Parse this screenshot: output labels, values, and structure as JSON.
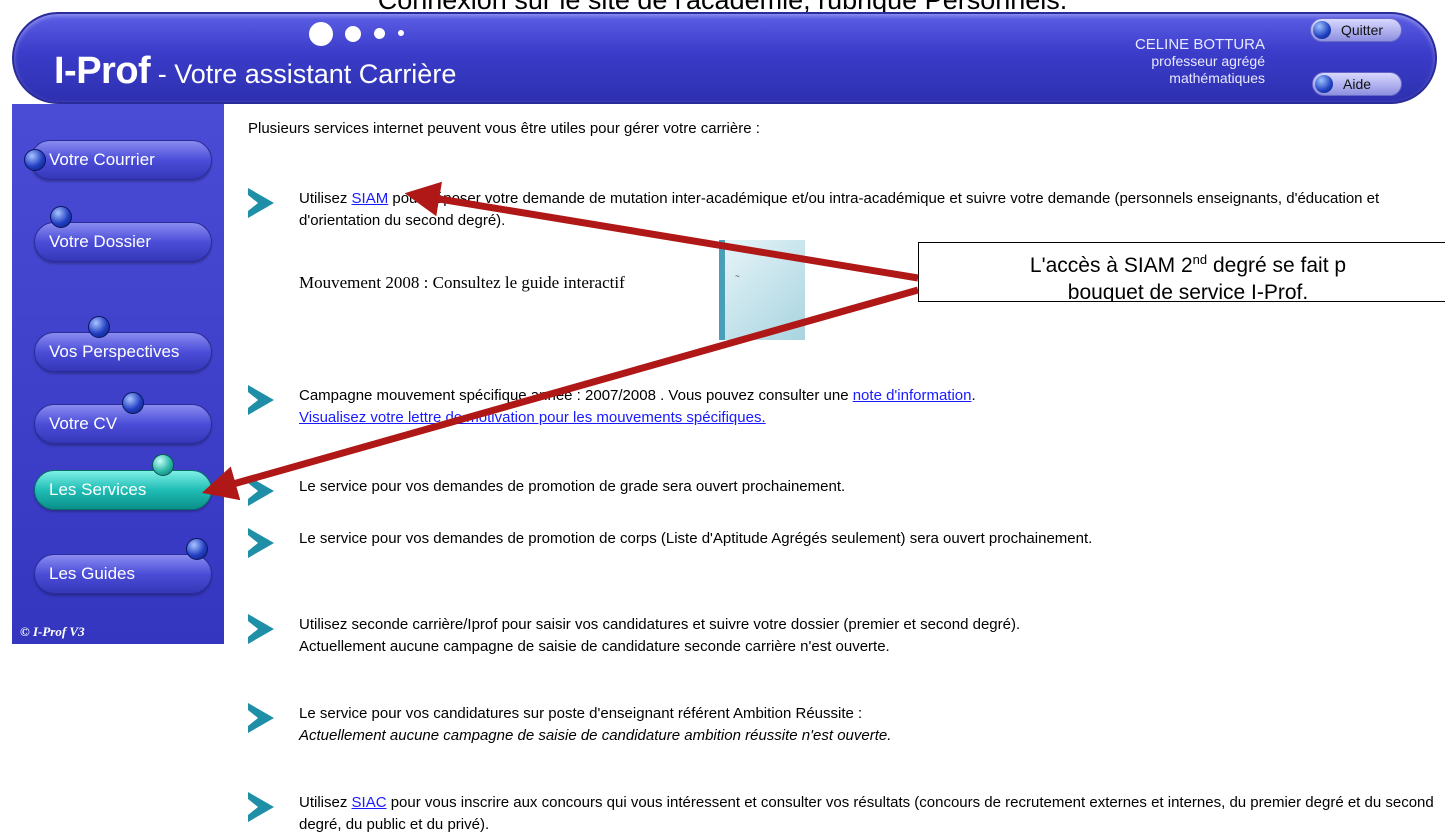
{
  "slide_caption": "Connexion sur le site de l'académie, rubrique Personnels.",
  "header": {
    "brand": "I-Prof",
    "subtitle": " - Votre assistant Carrière",
    "user_name": "CELINE BOTTURA",
    "user_role": "professeur agrégé",
    "user_subject": "mathématiques",
    "quit_label": "Quitter",
    "help_label": "Aide"
  },
  "sidebar": {
    "items": [
      {
        "label": "Votre Courrier"
      },
      {
        "label": "Votre Dossier"
      },
      {
        "label": "Vos Perspectives"
      },
      {
        "label": "Votre CV"
      },
      {
        "label": "Les Services",
        "active": true
      },
      {
        "label": "Les Guides"
      }
    ],
    "copyright": "© I-Prof  V3"
  },
  "main": {
    "intro": "Plusieurs services internet peuvent vous être utiles pour gérer votre carrière :",
    "items": [
      {
        "before": "Utilisez ",
        "link": "SIAM",
        "after": " pour déposer votre demande de mutation inter-académique et/ou intra-académique et suivre votre demande (personnels enseignants, d'éducation et d'orientation du second degré)."
      },
      {
        "line1": "Campagne mouvement spécifique année : 2007/2008 .    Vous pouvez consulter une ",
        "link1": "note d'information",
        "line1_end": ".",
        "link2": "Visualisez votre lettre de motivation pour les mouvements spécifiques."
      },
      {
        "text": "Le service pour vos demandes de promotion de grade sera ouvert prochainement."
      },
      {
        "text": "Le service pour vos demandes de promotion de corps (Liste d'Aptitude Agrégés seulement) sera ouvert prochainement."
      },
      {
        "line1": "Utilisez seconde carrière/Iprof pour saisir vos candidatures et suivre votre dossier (premier et second degré).",
        "line2": "Actuellement aucune campagne de saisie de candidature seconde carrière n'est ouverte."
      },
      {
        "line1": "Le service pour vos candidatures sur poste d'enseignant référent Ambition Réussite :",
        "line2": "Actuellement aucune campagne de saisie de candidature ambition réussite n'est ouverte."
      },
      {
        "before": "Utilisez ",
        "link": "SIAC",
        "after": " pour vous inscrire aux concours qui vous intéressent et consulter vos résultats (concours de recrutement externes et internes, du premier degré et du second degré, du public et du privé)."
      }
    ],
    "guide_text": "Mouvement 2008 : Consultez le guide interactif"
  },
  "callout": {
    "line1_a": "L'accès à SIAM 2",
    "line1_sup": "nd",
    "line1_b": " degré se fait p",
    "line2": "bouquet de service I-Prof."
  },
  "colors": {
    "header_blue": "#3a3cc9",
    "active_teal": "#1fbdb5",
    "arrow_red": "#b01818",
    "bullet_teal": "#1f8fa8",
    "link_blue": "#1a1aff"
  }
}
